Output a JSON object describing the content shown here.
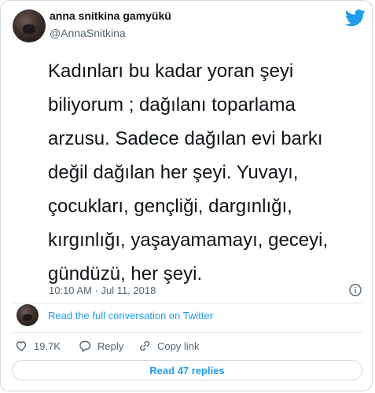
{
  "author": {
    "name": "anna snitkina gamyükü",
    "handle": "@AnnaSnitkina"
  },
  "tweet": {
    "text": "Kadınları bu kadar yoran şeyi\nbiliyorum ; dağılanı toparlama\narzusu. Sadece dağılan evi barkı\ndeğil dağılan her şeyi. Yuvayı,\nçocukları, gençliği, dargınlığı,\nkırgınlığı, yaşayamamayı, geceyi,\ngündüzü, her şeyi.",
    "timestamp": "10:10 AM · Jul 11, 2018"
  },
  "conversation_link": "Read the full conversation on Twitter",
  "actions": {
    "likes": "19.7K",
    "reply": "Reply",
    "copy_link": "Copy link"
  },
  "replies_button": "Read 47 replies",
  "icons": {
    "brand": "twitter-bird-icon",
    "info": "info-icon",
    "like": "heart-icon",
    "reply": "speech-bubble-icon",
    "copy": "link-icon"
  },
  "colors": {
    "accent": "#1d9bf0",
    "text": "#0f1419",
    "secondary": "#536471",
    "border": "#cfd9de"
  }
}
